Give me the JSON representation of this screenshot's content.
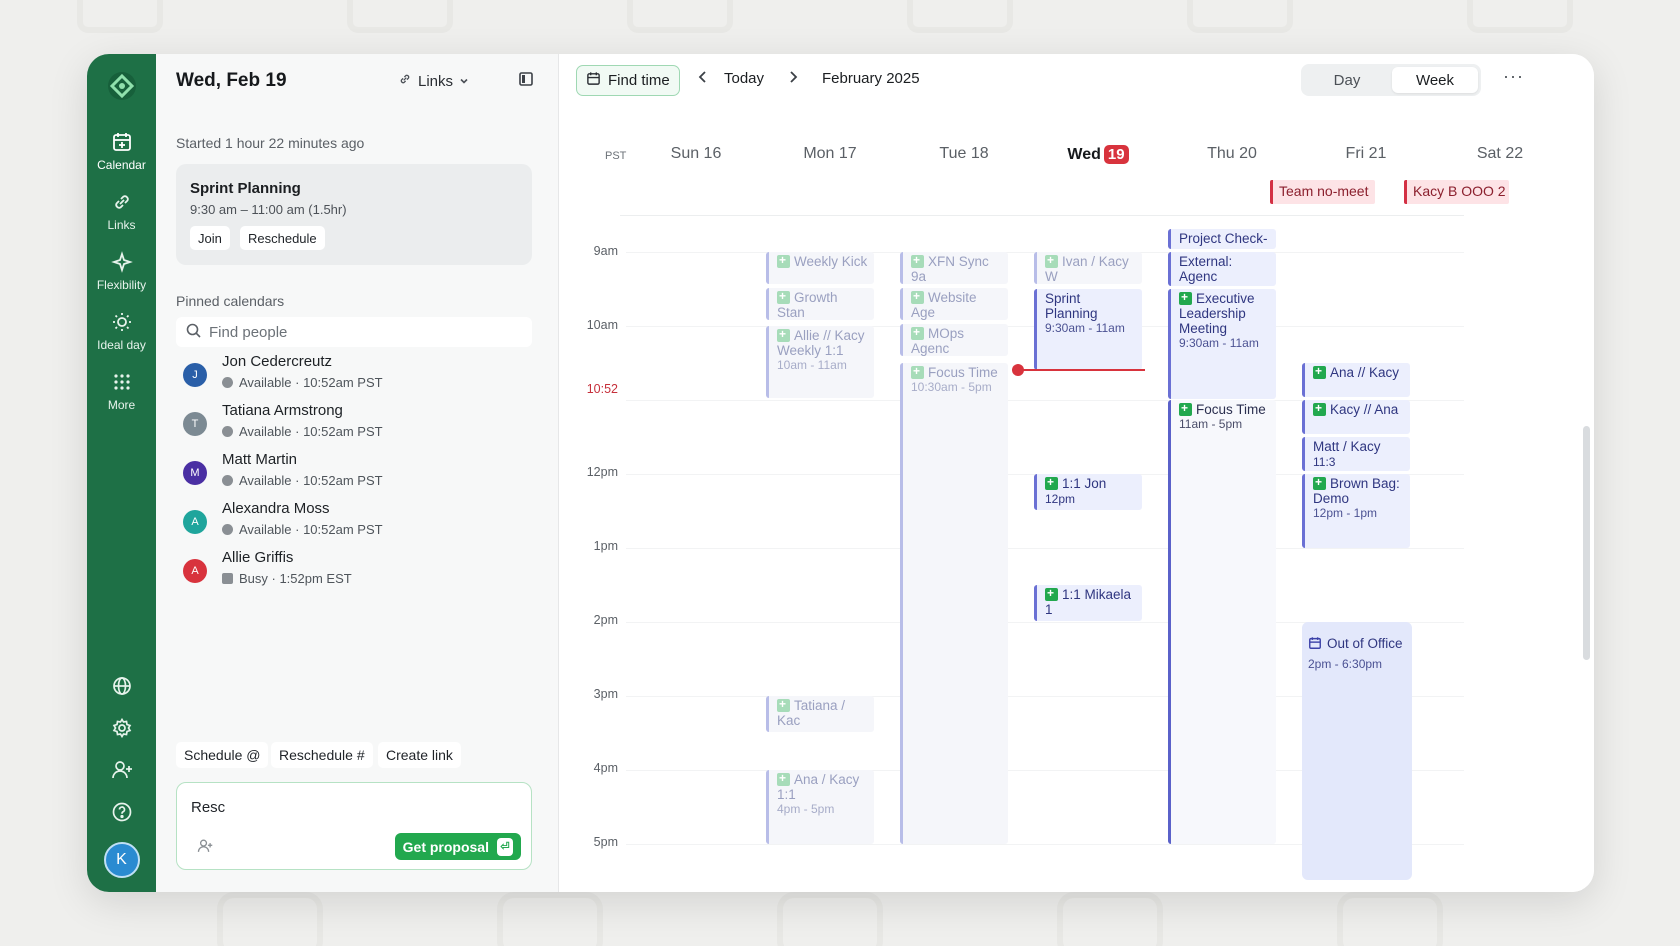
{
  "rail": {
    "items": [
      {
        "label": "Calendar",
        "icon": "calendar-plus-icon"
      },
      {
        "label": "Links",
        "icon": "link-icon"
      },
      {
        "label": "Flexibility",
        "icon": "sparkle-icon"
      },
      {
        "label": "Ideal day",
        "icon": "sun-icon"
      },
      {
        "label": "More",
        "icon": "grid-dots-icon"
      }
    ],
    "avatar_initial": "K"
  },
  "panel": {
    "date": "Wed, Feb 19",
    "links_label": "Links",
    "started": "Started 1 hour 22 minutes ago",
    "current_event": {
      "title": "Sprint Planning",
      "time": "9:30 am – 11:00 am (1.5hr)",
      "join_label": "Join",
      "reschedule_label": "Reschedule"
    },
    "pinned_title": "Pinned calendars",
    "find_people_placeholder": "Find people",
    "people": [
      {
        "initial": "J",
        "name": "Jon Cedercreutz",
        "status": "Available · 10:52am PST",
        "color": "#2a5fa8"
      },
      {
        "initial": "T",
        "name": "Tatiana Armstrong",
        "status": "Available · 10:52am PST",
        "color": "#7c8a93"
      },
      {
        "initial": "M",
        "name": "Matt Martin",
        "status": "Available · 10:52am PST",
        "color": "#4a2fa3"
      },
      {
        "initial": "A",
        "name": "Alexandra Moss",
        "status": "Available · 10:52am PST",
        "color": "#1fa59c"
      },
      {
        "initial": "A",
        "name": "Allie Griffis",
        "status": "Busy · 1:52pm EST",
        "color": "#d8333d"
      }
    ],
    "commands": [
      "Schedule @",
      "Reschedule #",
      "Create link"
    ],
    "compose_text": "Resc",
    "get_proposal_label": "Get proposal",
    "get_proposal_key": "⏎"
  },
  "toolbar": {
    "find_time_label": "Find time",
    "today_label": "Today",
    "month_label": "February 2025",
    "view_day": "Day",
    "view_week": "Week",
    "more": "···"
  },
  "calendar": {
    "timezone": "PST",
    "days": [
      {
        "label": "Sun 16"
      },
      {
        "label": "Mon 17"
      },
      {
        "label": "Tue 18"
      },
      {
        "label": "Wed",
        "badge": "19",
        "today": true
      },
      {
        "label": "Thu 20"
      },
      {
        "label": "Fri 21"
      },
      {
        "label": "Sat 22"
      }
    ],
    "times": [
      "9am",
      "10am",
      "10:52",
      "12pm",
      "1pm",
      "2pm",
      "3pm",
      "4pm",
      "5pm"
    ],
    "allday": {
      "thu": "Team no-meet",
      "fri": "Kacy B OOO 2"
    },
    "events": {
      "mon": {
        "weekly_kick": "Weekly Kick",
        "growth": "Growth Stan",
        "allie": "Allie // Kacy Weekly 1:1",
        "allie_time": "10am - 11am",
        "tatiana": "Tatiana / Kac",
        "ana": "Ana / Kacy 1:1",
        "ana_time": "4pm - 5pm"
      },
      "tue": {
        "xfn": "XFN Sync 9a",
        "website": "Website Age",
        "mops": "MOps Agenc",
        "focus": "Focus Time",
        "focus_time": "10:30am - 5pm"
      },
      "wed": {
        "ivan": "Ivan / Kacy W",
        "sprint": "Sprint Planning",
        "sprint_time": "9:30am - 11am",
        "jon": "1:1 Jon",
        "jon_time": "12pm",
        "mikaela": "1:1 Mikaela 1"
      },
      "thu": {
        "project": "Project Check-",
        "external": "External: Agenc",
        "exec": "Executive Leadership Meeting",
        "exec_time": "9:30am - 11am",
        "focus": "Focus Time",
        "focus_time": "11am - 5pm"
      },
      "fri": {
        "ana": "Ana // Kacy",
        "kacy": "Kacy // Ana",
        "matt": "Matt / Kacy",
        "matt_time": "11:3",
        "brown": "Brown Bag: Demo",
        "brown_time": "12pm - 1pm",
        "ooo": "Out of Office",
        "ooo_time": "2pm - 6:30pm"
      }
    }
  },
  "colors": {
    "brand_green": "#1e7046",
    "accent_green": "#22a84e",
    "now_red": "#d8333d",
    "event_purple": "#6a70d4"
  }
}
